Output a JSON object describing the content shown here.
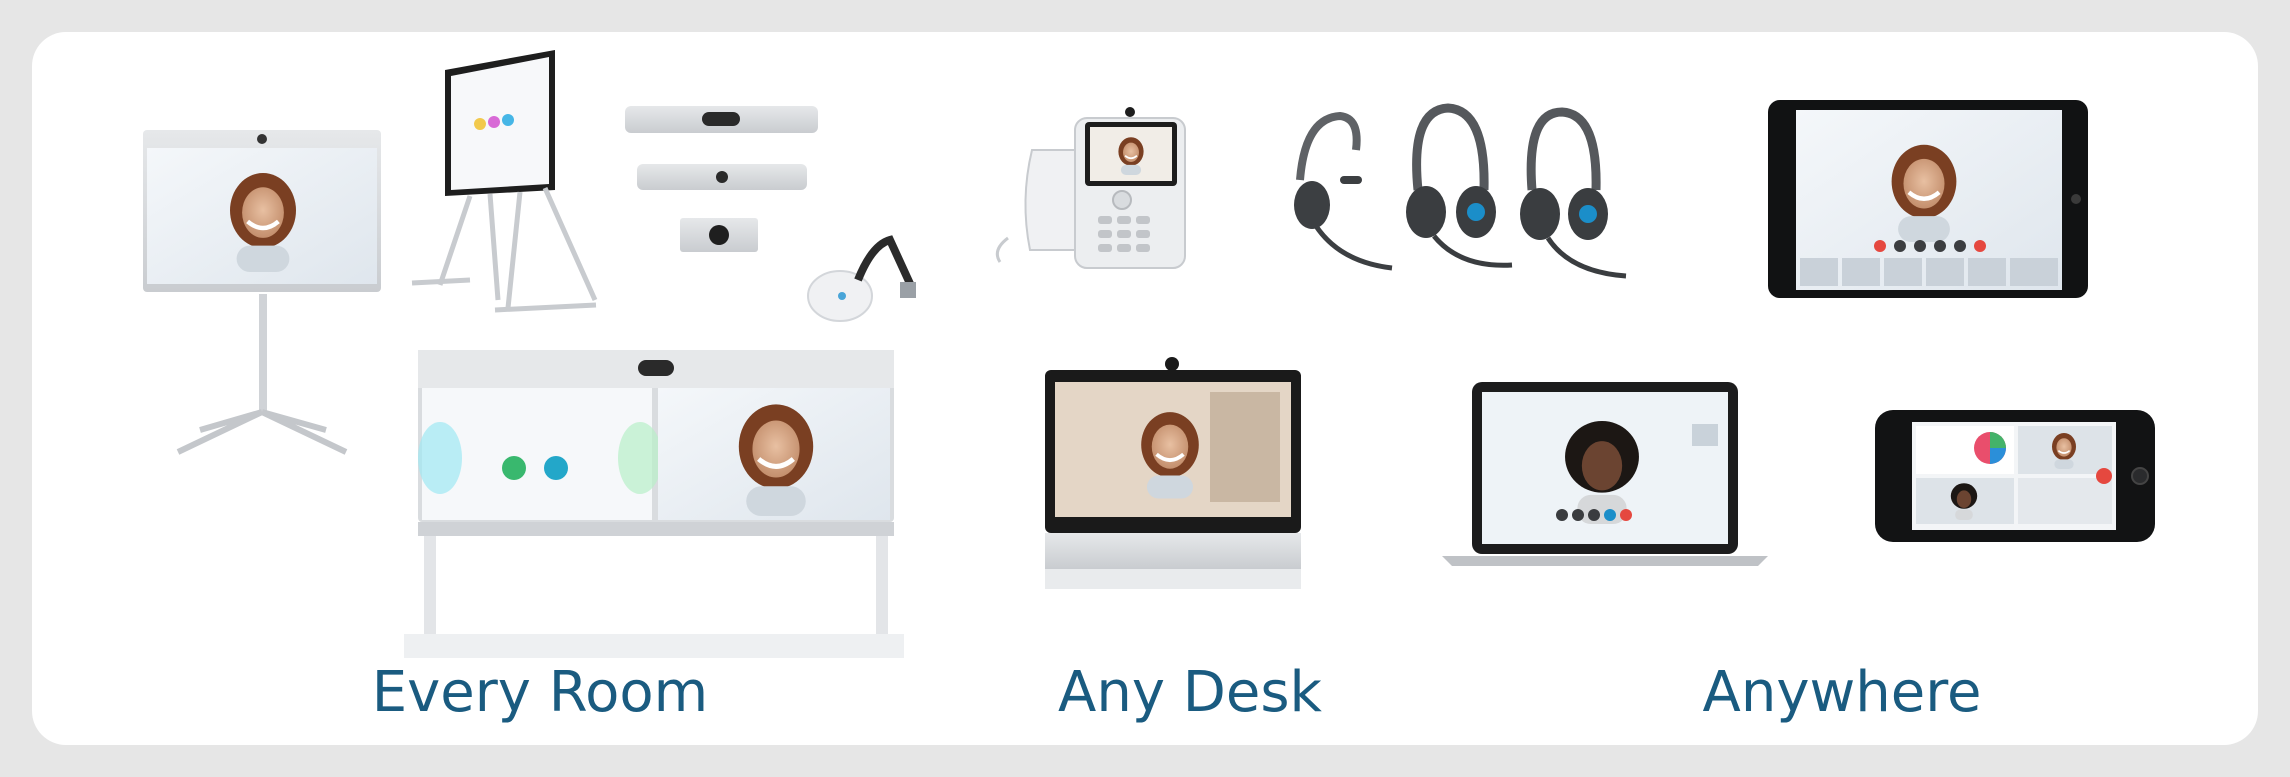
{
  "captions": {
    "every_room": "Every Room",
    "any_desk": "Any Desk",
    "anywhere": "Anywhere"
  },
  "colors": {
    "page_background": "#e6e6e6",
    "panel_background": "#ffffff",
    "caption_text": "#1a5b80",
    "device_frame": "#1b1b1b",
    "device_silver": "#d9dcdf"
  },
  "devices": [
    "room-kit-mini-stand",
    "board-on-easel",
    "room-bar",
    "room-kit-mini",
    "room-camera",
    "wireless-share-dongle",
    "ip-video-phone",
    "single-ear-headset",
    "dual-ear-headset-1",
    "dual-ear-headset-2",
    "tablet-meeting",
    "room-55-dual",
    "desk-pro",
    "laptop-meeting",
    "smartphone-meeting"
  ]
}
